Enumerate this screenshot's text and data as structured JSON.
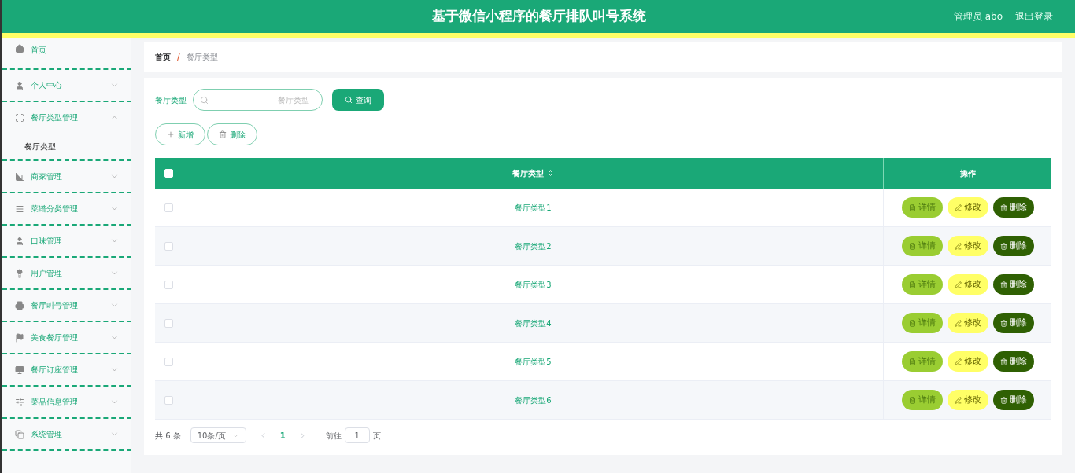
{
  "header": {
    "title": "基于微信小程序的餐厅排队叫号系统",
    "user": "管理员 abo",
    "logout": "退出登录"
  },
  "sidebar": {
    "items": [
      {
        "label": "首页",
        "expanded": false,
        "has_children": false
      },
      {
        "label": "个人中心",
        "expanded": false,
        "has_children": true
      },
      {
        "label": "餐厅类型管理",
        "expanded": true,
        "has_children": true,
        "children": [
          {
            "label": "餐厅类型",
            "selected": true
          }
        ]
      },
      {
        "label": "商家管理",
        "expanded": false,
        "has_children": true
      },
      {
        "label": "菜谱分类管理",
        "expanded": false,
        "has_children": true
      },
      {
        "label": "口味管理",
        "expanded": false,
        "has_children": true
      },
      {
        "label": "用户管理",
        "expanded": false,
        "has_children": true
      },
      {
        "label": "餐厅叫号管理",
        "expanded": false,
        "has_children": true
      },
      {
        "label": "美食餐厅管理",
        "expanded": false,
        "has_children": true
      },
      {
        "label": "餐厅订座管理",
        "expanded": false,
        "has_children": true
      },
      {
        "label": "菜品信息管理",
        "expanded": false,
        "has_children": true
      },
      {
        "label": "系统管理",
        "expanded": false,
        "has_children": true
      }
    ]
  },
  "breadcrumb": [
    "首页",
    "/",
    "餐厅类型"
  ],
  "search": {
    "label": "餐厅类型",
    "placeholder": "餐厅类型",
    "button": "查询"
  },
  "actions": [
    "新增",
    "删除"
  ],
  "table": {
    "columns": [
      "餐厅类型",
      "操作"
    ],
    "header_checked": false,
    "rows": [
      {
        "checked": false,
        "cells": [
          "餐厅类型1"
        ],
        "buttons": [
          "详情",
          "修改",
          "删除"
        ]
      },
      {
        "checked": false,
        "cells": [
          "餐厅类型2"
        ],
        "buttons": [
          "详情",
          "修改",
          "删除"
        ]
      },
      {
        "checked": false,
        "cells": [
          "餐厅类型3"
        ],
        "buttons": [
          "详情",
          "修改",
          "删除"
        ]
      },
      {
        "checked": false,
        "cells": [
          "餐厅类型4"
        ],
        "buttons": [
          "详情",
          "修改",
          "删除"
        ]
      },
      {
        "checked": false,
        "cells": [
          "餐厅类型5"
        ],
        "buttons": [
          "详情",
          "修改",
          "删除"
        ]
      },
      {
        "checked": false,
        "cells": [
          "餐厅类型6"
        ],
        "buttons": [
          "详情",
          "修改",
          "删除"
        ]
      }
    ]
  },
  "pagination": {
    "total": "共 6 条",
    "page_size": "10条/页",
    "pages": [
      {
        "label": "1",
        "selected": true
      }
    ],
    "goto": "前往",
    "goto_value": "1",
    "goto_suffix": "页"
  }
}
